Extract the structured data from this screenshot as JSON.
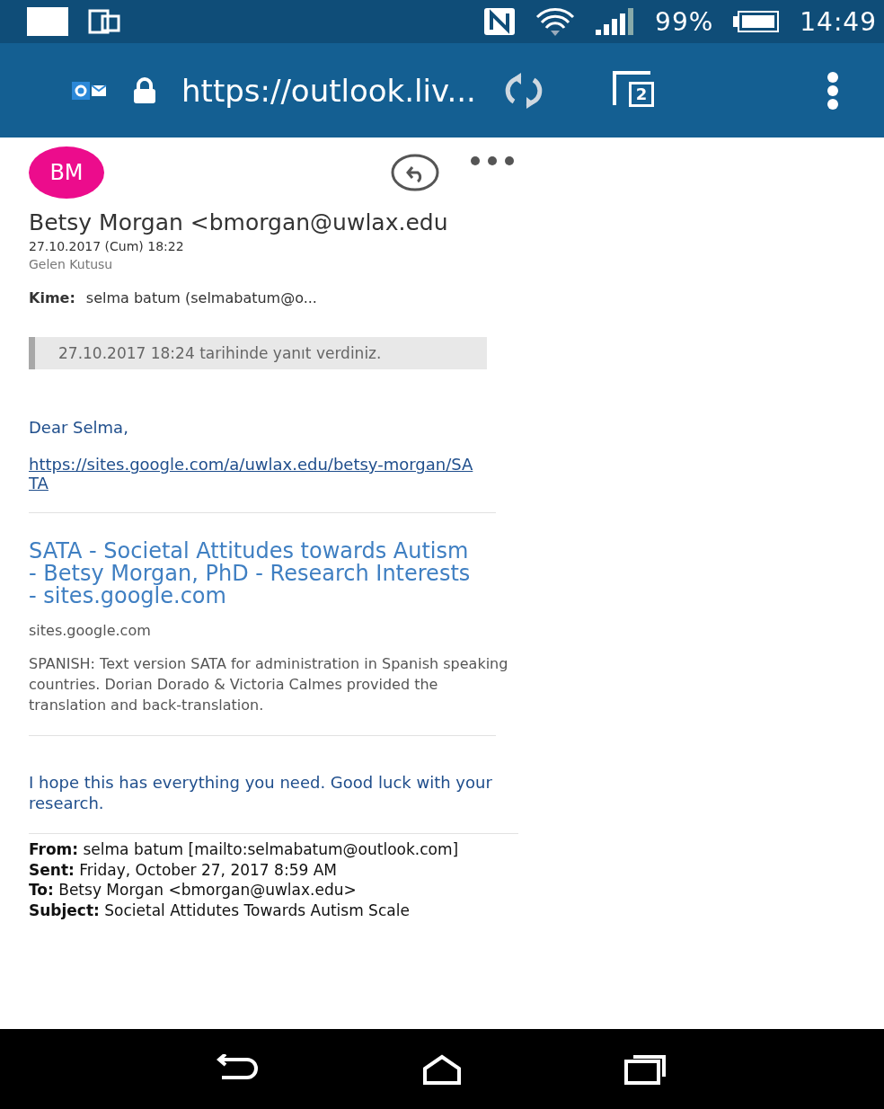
{
  "status_bar": {
    "battery": "99%",
    "time": "14:49"
  },
  "browser": {
    "url": "https://outlook.liv...",
    "tab_count": "2"
  },
  "message": {
    "avatar": "BM",
    "sender": "Betsy Morgan <bmorgan@uwlax.edu",
    "date": "27.10.2017 (Cum) 18:22",
    "folder": "Gelen Kutusu",
    "to_label": "Kime:",
    "to": "selma batum (selmabatum@o...",
    "reply_notice": "27.10.2017 18:24 tarihinde yanıt verdiniz."
  },
  "body": {
    "greeting": "Dear Selma,",
    "link": "https://sites.google.com/a/uwlax.edu/betsy-morgan/SATA",
    "preview": {
      "title": "SATA - Societal Attitudes towards Autism - Betsy Morgan, PhD - Research Interests - sites.google.com",
      "domain": "sites.google.com",
      "description": "SPANISH: Text version SATA for administration in Spanish speaking countries. Dorian Dorado & Victoria Calmes provided the translation and back-translation."
    },
    "closing": "I hope this has everything you need.  Good luck with your research."
  },
  "quoted_header": [
    {
      "line": "**From:** selma batum [mailto:selmabatum@outlook.com]"
    },
    {
      "line": "**Sent:** Friday, October 27, 2017 8:59 AM"
    },
    {
      "line": "**To:** Betsy Morgan <bmorgan@uwlax.edu>"
    },
    {
      "line": "**Subject:** Societal Attidutes Towards Autism Scale"
    }
  ]
}
